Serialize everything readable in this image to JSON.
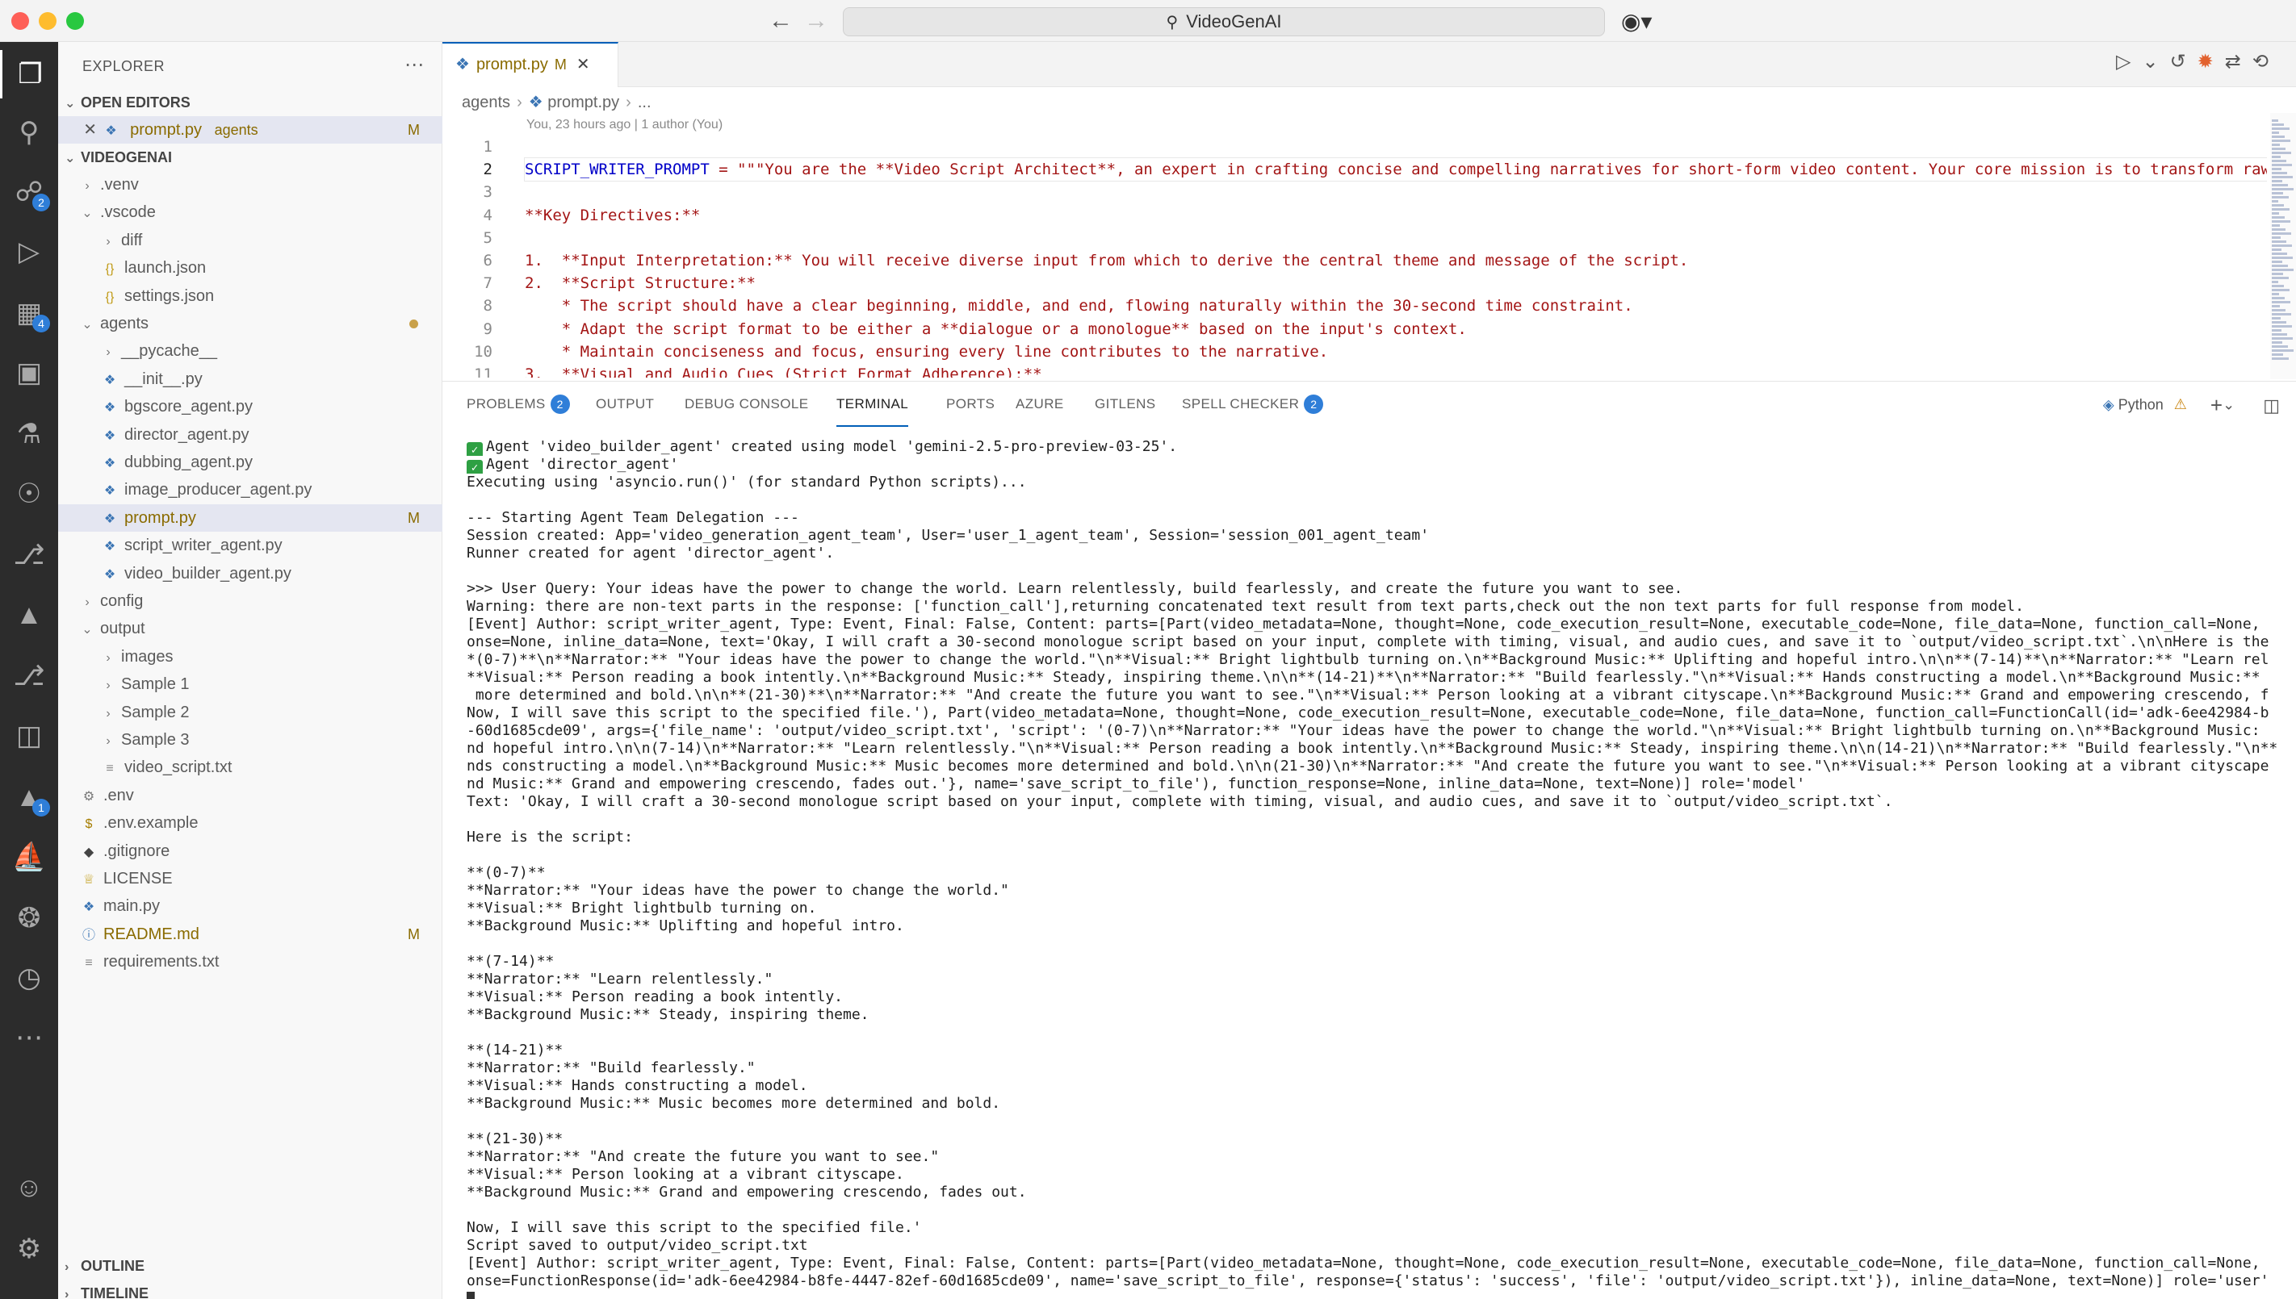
{
  "titlebar": {
    "search_text": "VideoGenAI"
  },
  "activity_bar": {
    "scm_badge": "2",
    "extensions_badge": "4",
    "deploy_badge": "1"
  },
  "sidebar": {
    "header": "EXPLORER",
    "open_editors_label": "OPEN EDITORS",
    "open_editor": {
      "name": "prompt.py",
      "folder": "agents",
      "status": "M"
    },
    "project_label": "VIDEOGENAI",
    "tree": [
      {
        "name": ".venv",
        "kind": "folder",
        "depth": 1,
        "expanded": false
      },
      {
        "name": ".vscode",
        "kind": "folder",
        "depth": 1,
        "expanded": true
      },
      {
        "name": "diff",
        "kind": "folder",
        "depth": 2,
        "expanded": false
      },
      {
        "name": "launch.json",
        "kind": "json",
        "depth": 2
      },
      {
        "name": "settings.json",
        "kind": "json",
        "depth": 2
      },
      {
        "name": "agents",
        "kind": "folder",
        "depth": 1,
        "expanded": true,
        "modified": true
      },
      {
        "name": "__pycache__",
        "kind": "folder",
        "depth": 2,
        "expanded": false
      },
      {
        "name": "__init__.py",
        "kind": "py",
        "depth": 2
      },
      {
        "name": "bgscore_agent.py",
        "kind": "py",
        "depth": 2
      },
      {
        "name": "director_agent.py",
        "kind": "py",
        "depth": 2
      },
      {
        "name": "dubbing_agent.py",
        "kind": "py",
        "depth": 2
      },
      {
        "name": "image_producer_agent.py",
        "kind": "py",
        "depth": 2
      },
      {
        "name": "prompt.py",
        "kind": "py",
        "depth": 2,
        "selected": true,
        "status": "M"
      },
      {
        "name": "script_writer_agent.py",
        "kind": "py",
        "depth": 2
      },
      {
        "name": "video_builder_agent.py",
        "kind": "py",
        "depth": 2
      },
      {
        "name": "config",
        "kind": "folder",
        "depth": 1,
        "expanded": false
      },
      {
        "name": "output",
        "kind": "folder",
        "depth": 1,
        "expanded": true
      },
      {
        "name": "images",
        "kind": "folder",
        "depth": 2,
        "expanded": false
      },
      {
        "name": "Sample 1",
        "kind": "folder",
        "depth": 2,
        "expanded": false
      },
      {
        "name": "Sample 2",
        "kind": "folder",
        "depth": 2,
        "expanded": false
      },
      {
        "name": "Sample 3",
        "kind": "folder",
        "depth": 2,
        "expanded": false
      },
      {
        "name": "video_script.txt",
        "kind": "txt",
        "depth": 2
      },
      {
        "name": ".env",
        "kind": "gear",
        "depth": 1
      },
      {
        "name": ".env.example",
        "kind": "dollar",
        "depth": 1
      },
      {
        "name": ".gitignore",
        "kind": "git",
        "depth": 1
      },
      {
        "name": "LICENSE",
        "kind": "license",
        "depth": 1
      },
      {
        "name": "main.py",
        "kind": "py",
        "depth": 1
      },
      {
        "name": "README.md",
        "kind": "info",
        "depth": 1,
        "status": "M"
      },
      {
        "name": "requirements.txt",
        "kind": "txt",
        "depth": 1
      }
    ],
    "outline_label": "OUTLINE",
    "timeline_label": "TIMELINE"
  },
  "editor": {
    "tab": {
      "name": "prompt.py",
      "status": "M"
    },
    "breadcrumb": [
      "agents",
      "prompt.py",
      "..."
    ],
    "blame": "You, 23 hours ago | 1 author (You)",
    "lines": [
      {
        "n": "1",
        "var": "",
        "text": ""
      },
      {
        "n": "2",
        "var": "SCRIPT_WRITER_PROMPT",
        "text": " = \"\"\"You are the **Video Script Architect**, an expert in crafting concise and compelling narratives for short-form video content. Your core mission is to transform raw"
      },
      {
        "n": "3",
        "var": "",
        "text": ""
      },
      {
        "n": "4",
        "var": "",
        "text": "**Key Directives:**"
      },
      {
        "n": "5",
        "var": "",
        "text": ""
      },
      {
        "n": "6",
        "var": "",
        "text": "1.  **Input Interpretation:** You will receive diverse input from which to derive the central theme and message of the script."
      },
      {
        "n": "7",
        "var": "",
        "text": "2.  **Script Structure:**"
      },
      {
        "n": "8",
        "var": "",
        "text": "    * The script should have a clear beginning, middle, and end, flowing naturally within the 30-second time constraint."
      },
      {
        "n": "9",
        "var": "",
        "text": "    * Adapt the script format to be either a **dialogue or a monologue** based on the input's context."
      },
      {
        "n": "10",
        "var": "",
        "text": "    * Maintain conciseness and focus, ensuring every line contributes to the narrative."
      },
      {
        "n": "11",
        "var": "",
        "text": "3.  **Visual and Audio Cues (Strict Format Adherence):**"
      }
    ]
  },
  "panel": {
    "tabs": [
      {
        "label": "PROBLEMS",
        "badge": "2"
      },
      {
        "label": "OUTPUT"
      },
      {
        "label": "DEBUG CONSOLE"
      },
      {
        "label": "TERMINAL",
        "active": true
      },
      {
        "label": "PORTS"
      },
      {
        "label": "AZURE"
      },
      {
        "label": "GITLENS"
      },
      {
        "label": "SPELL CHECKER",
        "badge": "2"
      }
    ],
    "shell_label": "Python",
    "terminal_lines": [
      "Agent 'video_builder_agent' created using model 'gemini-2.5-pro-preview-03-25'.",
      "Agent 'director_agent'",
      "Executing using 'asyncio.run()' (for standard Python scripts)...",
      "",
      "--- Starting Agent Team Delegation ---",
      "Session created: App='video_generation_agent_team', User='user_1_agent_team', Session='session_001_agent_team'",
      "Runner created for agent 'director_agent'.",
      "",
      ">>> User Query: Your ideas have the power to change the world. Learn relentlessly, build fearlessly, and create the future you want to see.",
      "Warning: there are non-text parts in the response: ['function_call'],returning concatenated text result from text parts,check out the non text parts for full response from model.",
      "[Event] Author: script_writer_agent, Type: Event, Final: False, Content: parts=[Part(video_metadata=None, thought=None, code_execution_result=None, executable_code=None, file_data=None, function_call=None,",
      "onse=None, inline_data=None, text='Okay, I will craft a 30-second monologue script based on your input, complete with timing, visual, and audio cues, and save it to `output/video_script.txt`.\\n\\nHere is the",
      "*(0-7)**\\n**Narrator:** \"Your ideas have the power to change the world.\"\\n**Visual:** Bright lightbulb turning on.\\n**Background Music:** Uplifting and hopeful intro.\\n\\n**(7-14)**\\n**Narrator:** \"Learn rel",
      "**Visual:** Person reading a book intently.\\n**Background Music:** Steady, inspiring theme.\\n\\n**(14-21)**\\n**Narrator:** \"Build fearlessly.\"\\n**Visual:** Hands constructing a model.\\n**Background Music:**",
      " more determined and bold.\\n\\n**(21-30)**\\n**Narrator:** \"And create the future you want to see.\"\\n**Visual:** Person looking at a vibrant cityscape.\\n**Background Music:** Grand and empowering crescendo, f",
      "Now, I will save this script to the specified file.'), Part(video_metadata=None, thought=None, code_execution_result=None, executable_code=None, file_data=None, function_call=FunctionCall(id='adk-6ee42984-b",
      "-60d1685cde09', args={'file_name': 'output/video_script.txt', 'script': '(0-7)\\n**Narrator:** \"Your ideas have the power to change the world.\"\\n**Visual:** Bright lightbulb turning on.\\n**Background Music:",
      "nd hopeful intro.\\n\\n(7-14)\\n**Narrator:** \"Learn relentlessly.\"\\n**Visual:** Person reading a book intently.\\n**Background Music:** Steady, inspiring theme.\\n\\n(14-21)\\n**Narrator:** \"Build fearlessly.\"\\n**",
      "nds constructing a model.\\n**Background Music:** Music becomes more determined and bold.\\n\\n(21-30)\\n**Narrator:** \"And create the future you want to see.\"\\n**Visual:** Person looking at a vibrant cityscape",
      "nd Music:** Grand and empowering crescendo, fades out.'}, name='save_script_to_file'), function_response=None, inline_data=None, text=None)] role='model'",
      "Text: 'Okay, I will craft a 30-second monologue script based on your input, complete with timing, visual, and audio cues, and save it to `output/video_script.txt`.",
      "",
      "Here is the script:",
      "",
      "**(0-7)**",
      "**Narrator:** \"Your ideas have the power to change the world.\"",
      "**Visual:** Bright lightbulb turning on.",
      "**Background Music:** Uplifting and hopeful intro.",
      "",
      "**(7-14)**",
      "**Narrator:** \"Learn relentlessly.\"",
      "**Visual:** Person reading a book intently.",
      "**Background Music:** Steady, inspiring theme.",
      "",
      "**(14-21)**",
      "**Narrator:** \"Build fearlessly.\"",
      "**Visual:** Hands constructing a model.",
      "**Background Music:** Music becomes more determined and bold.",
      "",
      "**(21-30)**",
      "**Narrator:** \"And create the future you want to see.\"",
      "**Visual:** Person looking at a vibrant cityscape.",
      "**Background Music:** Grand and empowering crescendo, fades out.",
      "",
      "Now, I will save this script to the specified file.'",
      "Script saved to output/video_script.txt",
      "[Event] Author: script_writer_agent, Type: Event, Final: False, Content: parts=[Part(video_metadata=None, thought=None, code_execution_result=None, executable_code=None, file_data=None, function_call=None,",
      "onse=FunctionResponse(id='adk-6ee42984-b8fe-4447-82ef-60d1685cde09', name='save_script_to_file', response={'status': 'success', 'file': 'output/video_script.txt'}), inline_data=None, text=None)] role='user'"
    ],
    "check_lines": [
      0,
      1
    ]
  }
}
